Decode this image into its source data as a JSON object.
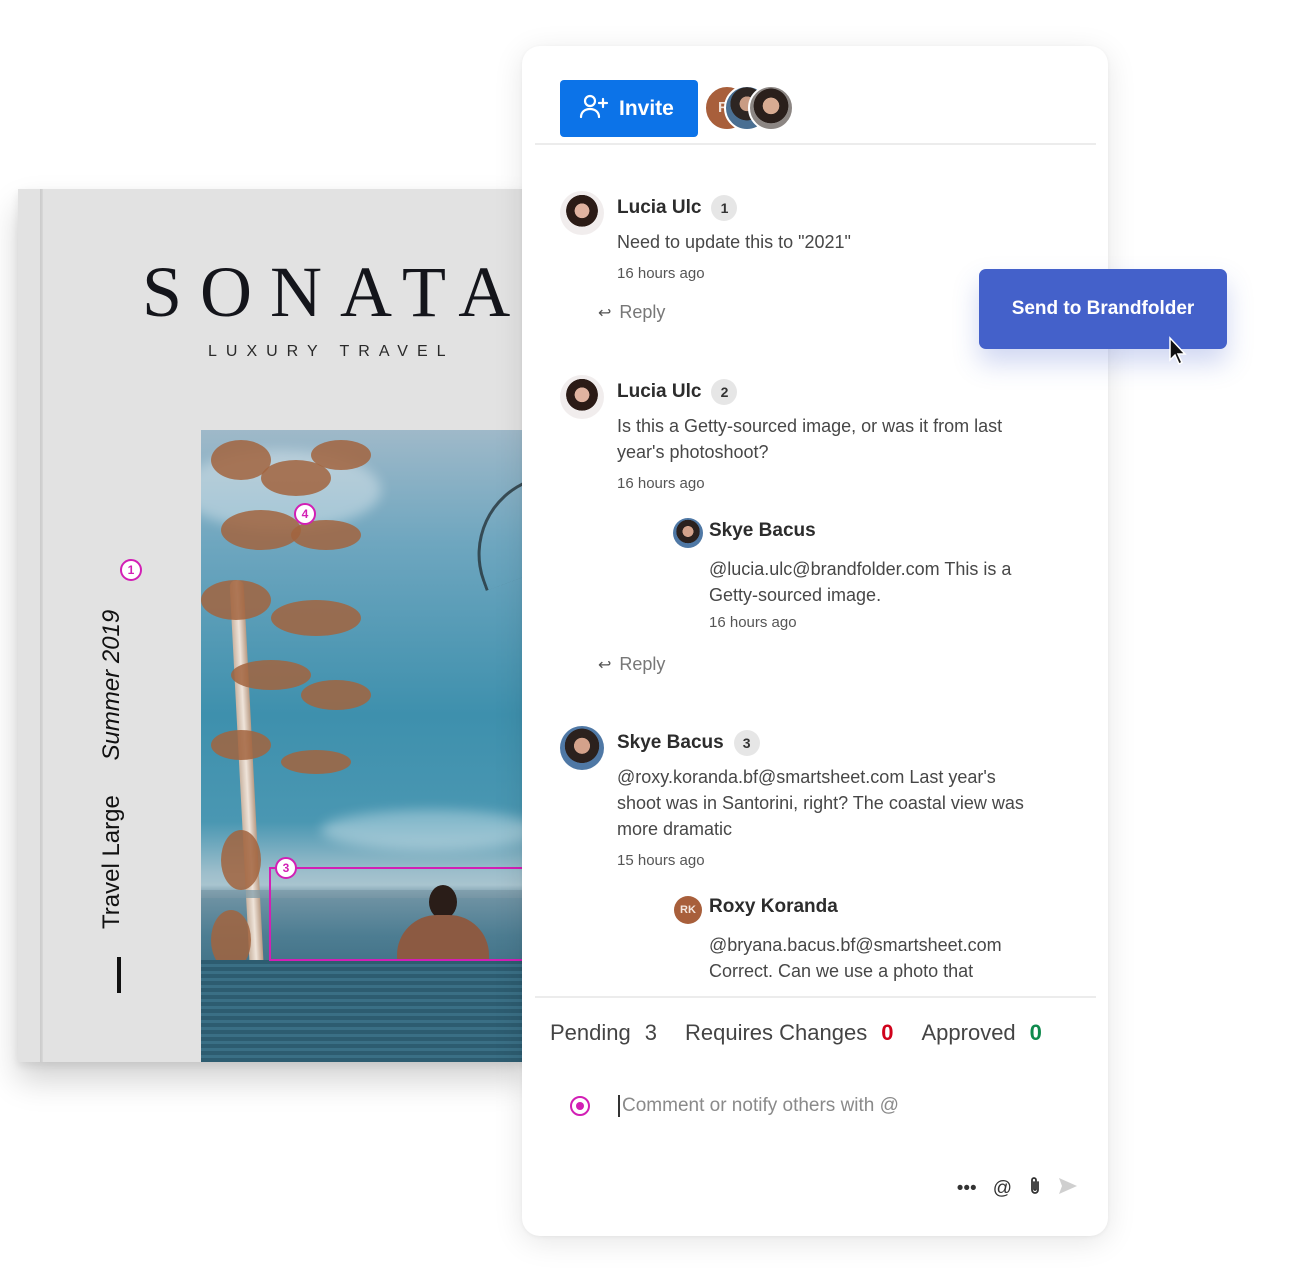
{
  "magazine": {
    "title": "SONATA",
    "subtitle": "LUXURY TRAVEL",
    "spine_text_primary": "Travel Large",
    "spine_text_secondary": "Summer 2019",
    "annotation_pins": [
      "1",
      "3",
      "4"
    ]
  },
  "header": {
    "invite_label": "Invite",
    "collaborators": [
      {
        "type": "initials",
        "label": "R"
      },
      {
        "type": "photo",
        "label": ""
      },
      {
        "type": "photo",
        "label": ""
      }
    ]
  },
  "comments": [
    {
      "author": "Lucia Ulc",
      "number": "1",
      "body": "Need to update this to \"2021\"",
      "time": "16 hours ago",
      "reply_label": "Reply"
    },
    {
      "author": "Lucia Ulc",
      "number": "2",
      "body": "Is this a Getty-sourced image, or was it from last year's photoshoot?",
      "time": "16 hours ago",
      "reply_label": "Reply",
      "replies": [
        {
          "author": "Skye Bacus",
          "body": "@lucia.ulc@brandfolder.com This is a Getty-sourced image.",
          "time": "16 hours ago"
        }
      ]
    },
    {
      "author": "Skye Bacus",
      "number": "3",
      "body": "@roxy.koranda.bf@smartsheet.com Last year's shoot was in Santorini, right? The coastal view was more dramatic",
      "time": "15 hours ago",
      "replies": [
        {
          "author": "Roxy Koranda",
          "initials": "RK",
          "body": "@bryana.bacus.bf@smartsheet.com Correct. Can we use a photo that"
        }
      ]
    }
  ],
  "status": {
    "pending_label": "Pending",
    "pending_count": "3",
    "changes_label": "Requires Changes",
    "changes_count": "0",
    "approved_label": "Approved",
    "approved_count": "0",
    "colors": {
      "changes": "#d0021b",
      "approved": "#0f8a4d"
    }
  },
  "composer": {
    "placeholder": "Comment or notify others with @",
    "value": "",
    "tools": [
      "more-icon",
      "mention-icon",
      "attach-icon",
      "send-icon"
    ]
  },
  "floating_button": {
    "label": "Send to Brandfolder",
    "color": "#4461ca"
  },
  "colors": {
    "invite": "#0c73e8",
    "annotation": "#d21fb5"
  }
}
